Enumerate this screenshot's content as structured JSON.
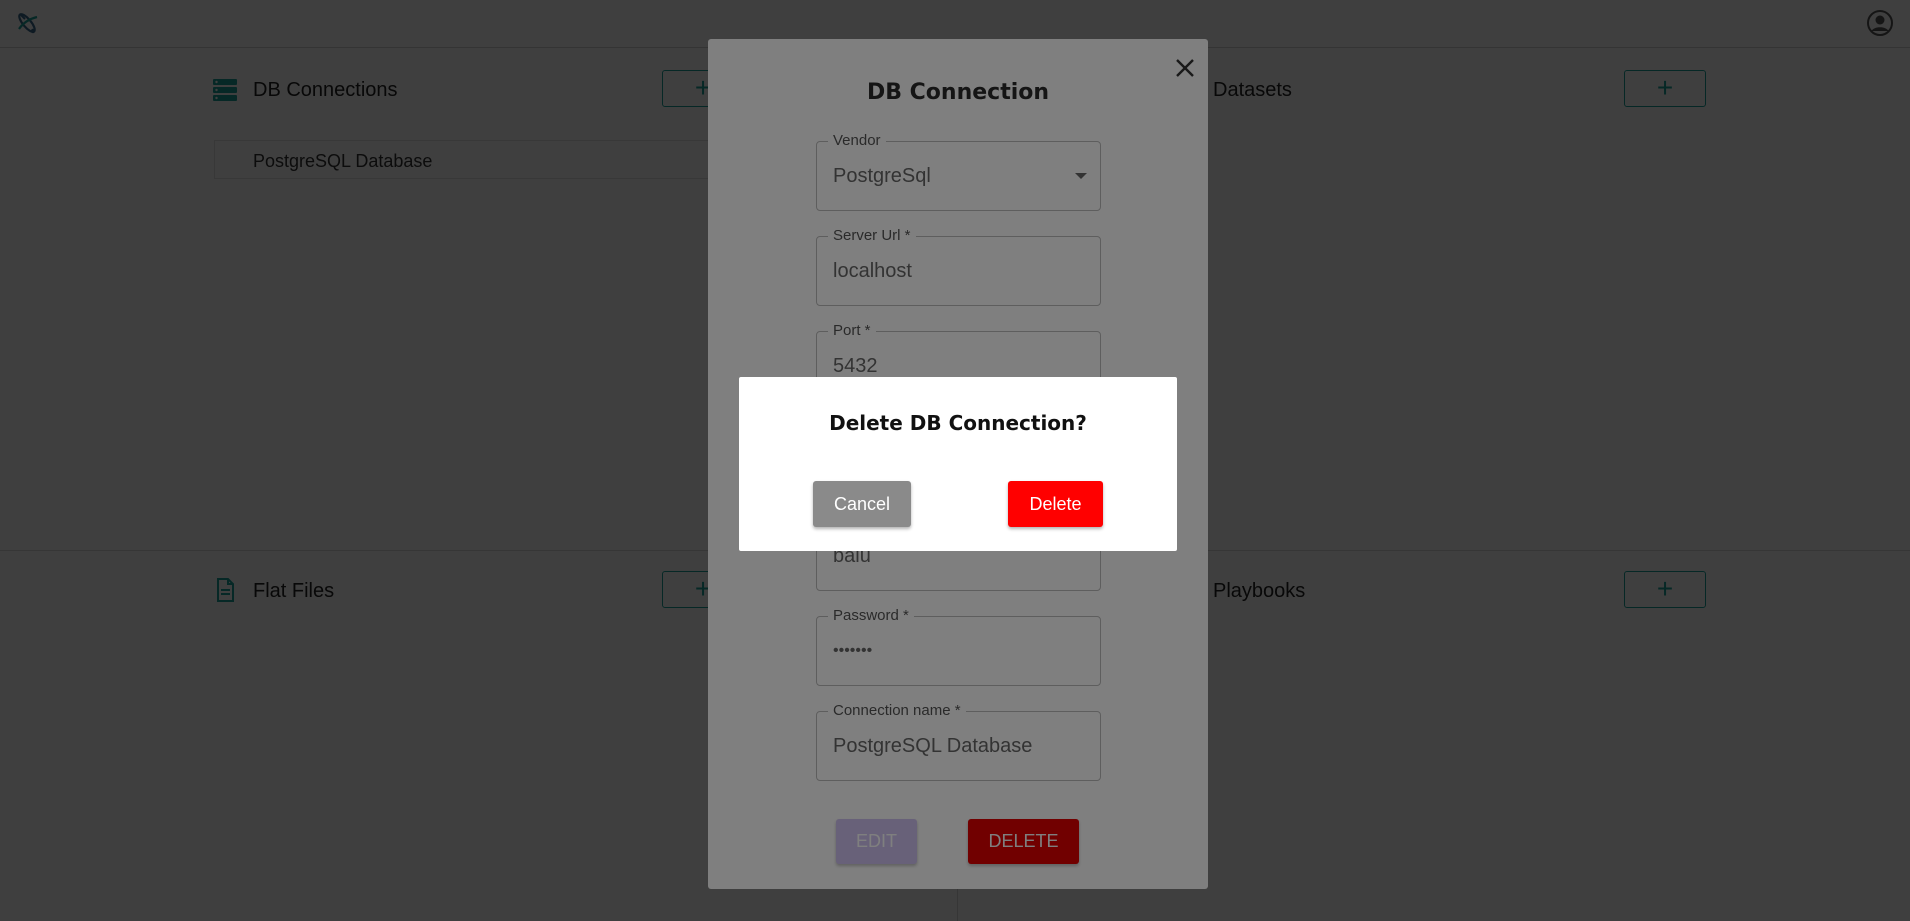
{
  "header": {
    "logo_icon": "satellite-logo-icon",
    "account_icon": "account-circle-icon"
  },
  "sections": {
    "db_connections": {
      "title": "DB Connections",
      "icon": "database-list-icon",
      "add_label": "+",
      "items": [
        "PostgreSQL Database"
      ]
    },
    "datasets": {
      "title": "Datasets",
      "add_label": "+"
    },
    "flat_files": {
      "title": "Flat Files",
      "icon": "document-icon",
      "add_label": "+"
    },
    "playbooks": {
      "title": "Playbooks",
      "add_label": "+"
    }
  },
  "modal": {
    "title": "DB Connection",
    "close_icon": "close-icon",
    "fields": {
      "vendor": {
        "label": "Vendor",
        "value": "PostgreSql"
      },
      "server_url": {
        "label": "Server Url *",
        "value": "localhost"
      },
      "port": {
        "label": "Port *",
        "value": "5432"
      },
      "username": {
        "value": "balu"
      },
      "password": {
        "label": "Password *",
        "value": "•••••••"
      },
      "connection_name": {
        "label": "Connection name *",
        "value": "PostgreSQL Database"
      }
    },
    "edit_label": "EDIT",
    "delete_label": "DELETE"
  },
  "confirm": {
    "title": "Delete DB Connection?",
    "cancel_label": "Cancel",
    "delete_label": "Delete"
  },
  "colors": {
    "accent": "#1aa39a",
    "danger": "#ff0000",
    "edit_disabled": "#d1c3f2",
    "cancel": "#8a8a8a"
  }
}
